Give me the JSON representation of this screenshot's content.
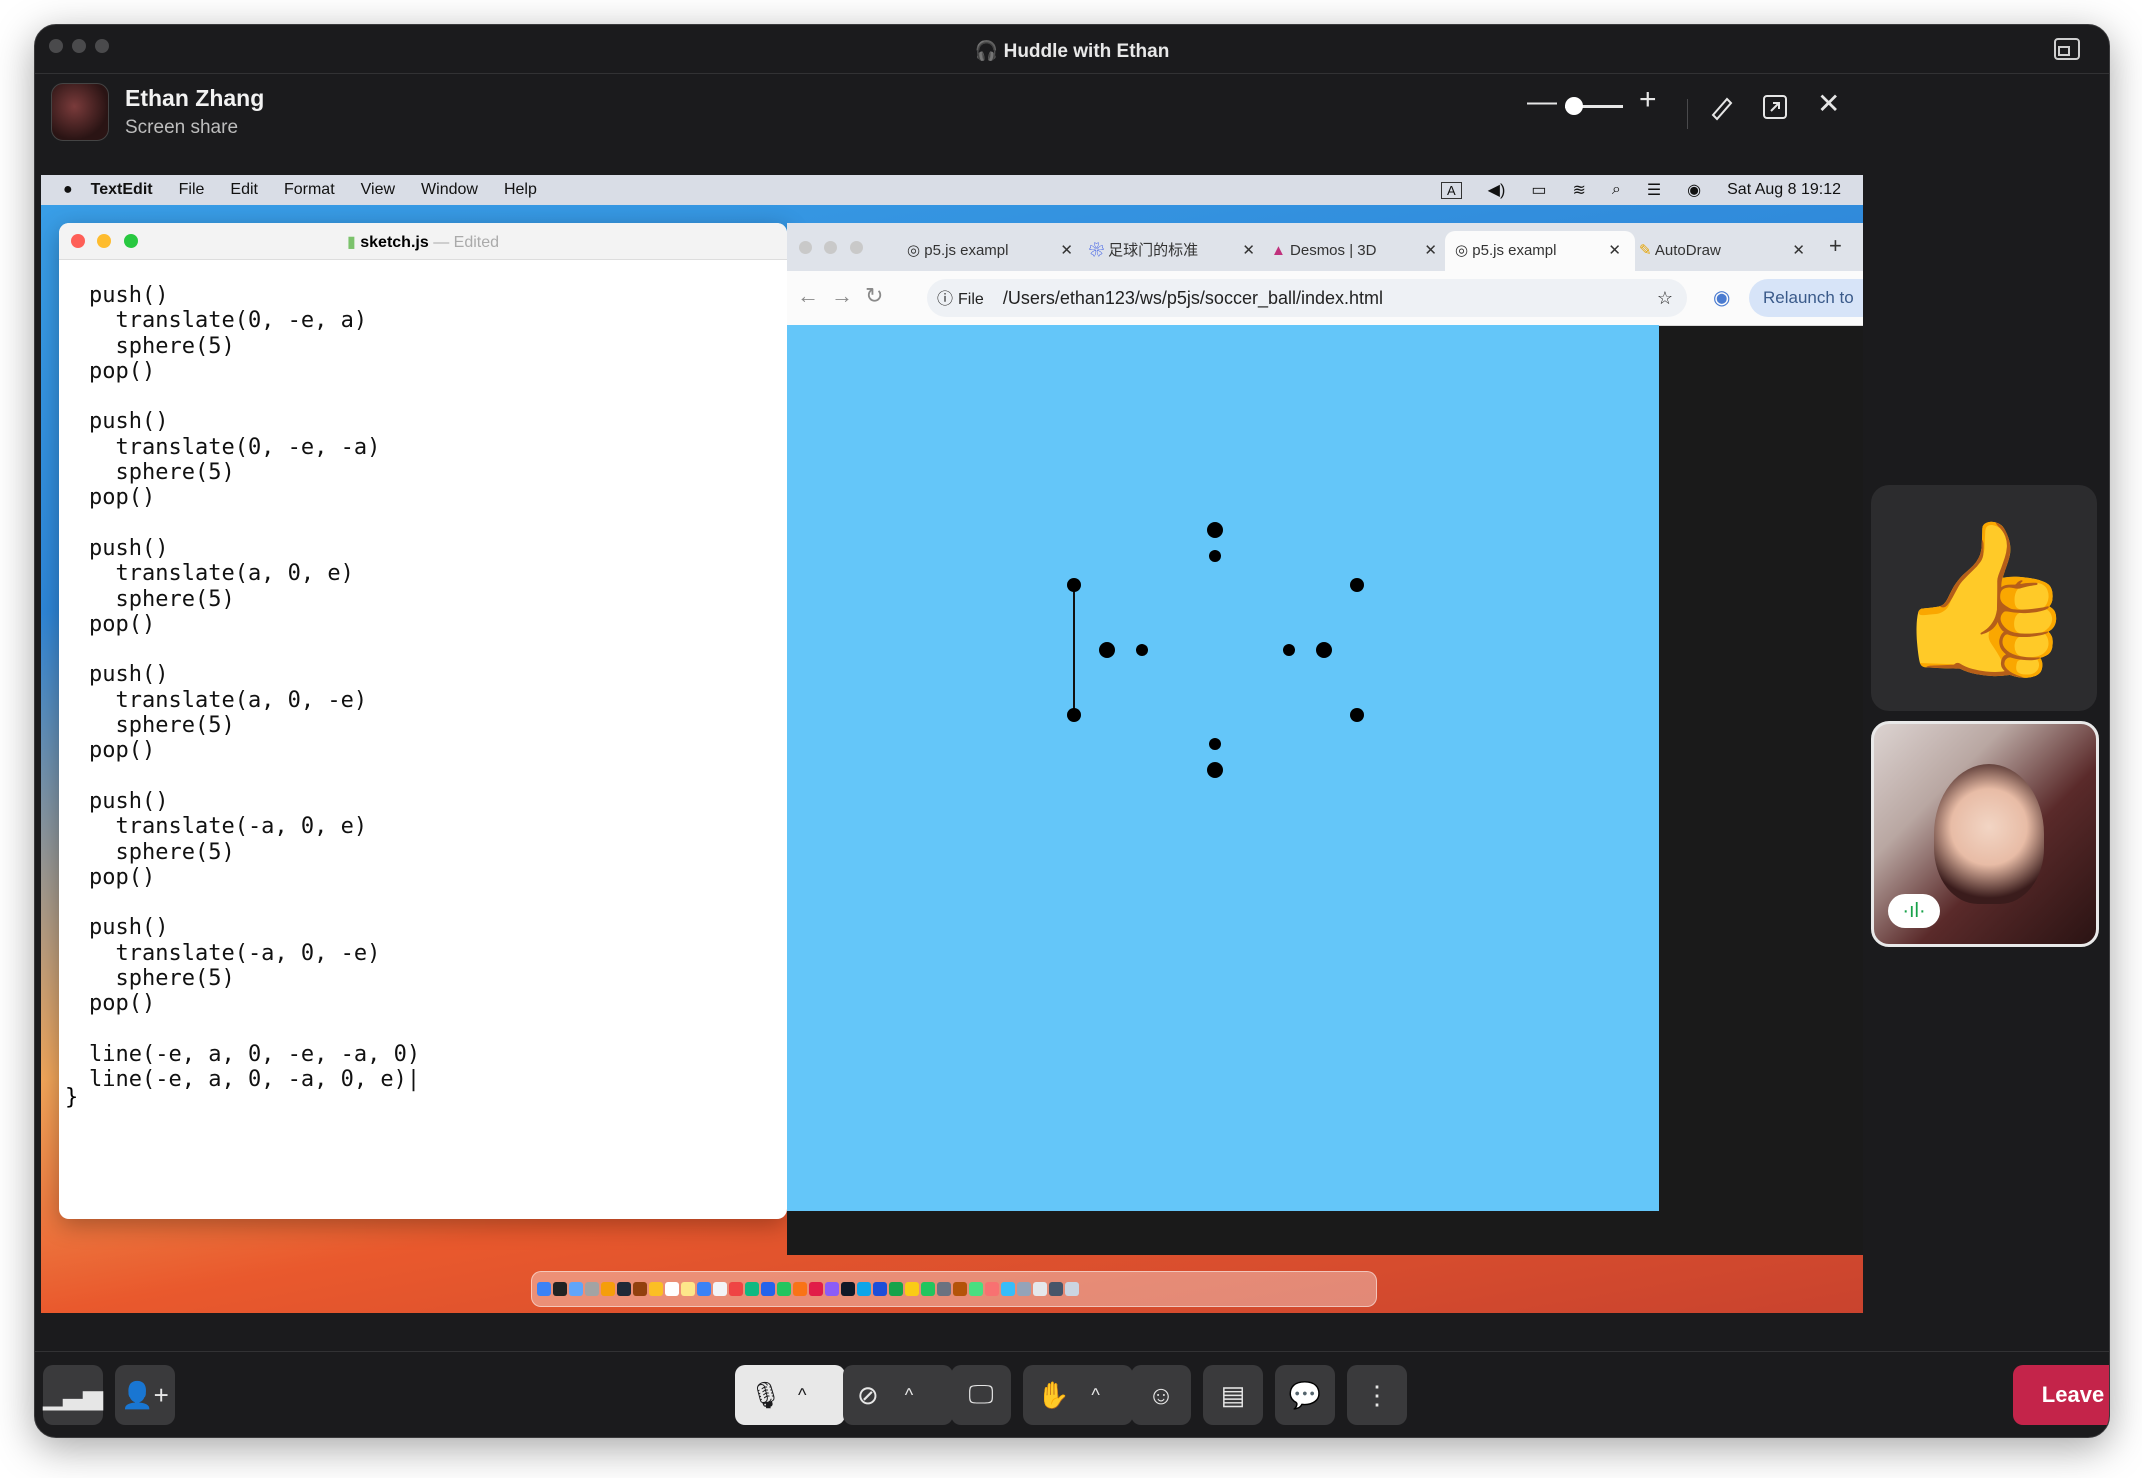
{
  "huddle": {
    "title": "Huddle with Ethan",
    "presenter_name": "Ethan Zhang",
    "presenter_status": "Screen share",
    "leave_label": "Leave"
  },
  "shared_screen": {
    "menubar": {
      "app": "TextEdit",
      "items": [
        "File",
        "Edit",
        "Format",
        "View",
        "Window",
        "Help"
      ],
      "input_indicator": "A",
      "datetime": "Sat Aug 8  19:12"
    },
    "textedit": {
      "filename": "sketch.js",
      "status": "Edited",
      "code": "push()\n  translate(0, -e, a)\n  sphere(5)\npop()\n\npush()\n  translate(0, -e, -a)\n  sphere(5)\npop()\n\npush()\n  translate(a, 0, e)\n  sphere(5)\npop()\n\npush()\n  translate(a, 0, -e)\n  sphere(5)\npop()\n\npush()\n  translate(-a, 0, e)\n  sphere(5)\npop()\n\npush()\n  translate(-a, 0, -e)\n  sphere(5)\npop()\n\nline(-e, a, 0, -e, -a, 0)\nline(-e, a, 0, -a, 0, e)|",
      "closing_brace": "}"
    },
    "browser": {
      "tabs": [
        {
          "label": "p5.js exampl"
        },
        {
          "label": "足球门的标准"
        },
        {
          "label": "Desmos | 3D"
        },
        {
          "label": "p5.js exampl"
        },
        {
          "label": "AutoDraw"
        }
      ],
      "url_scheme": "File",
      "url": "/Users/ethan123/ws/p5js/soccer_ball/index.html",
      "relaunch_label": "Relaunch to"
    }
  },
  "colors": {
    "window_bg": "#1b1b1d",
    "canvas_bg": "#64c6f9",
    "leave_bg": "#c4244a",
    "speaking": "#18a24a"
  }
}
